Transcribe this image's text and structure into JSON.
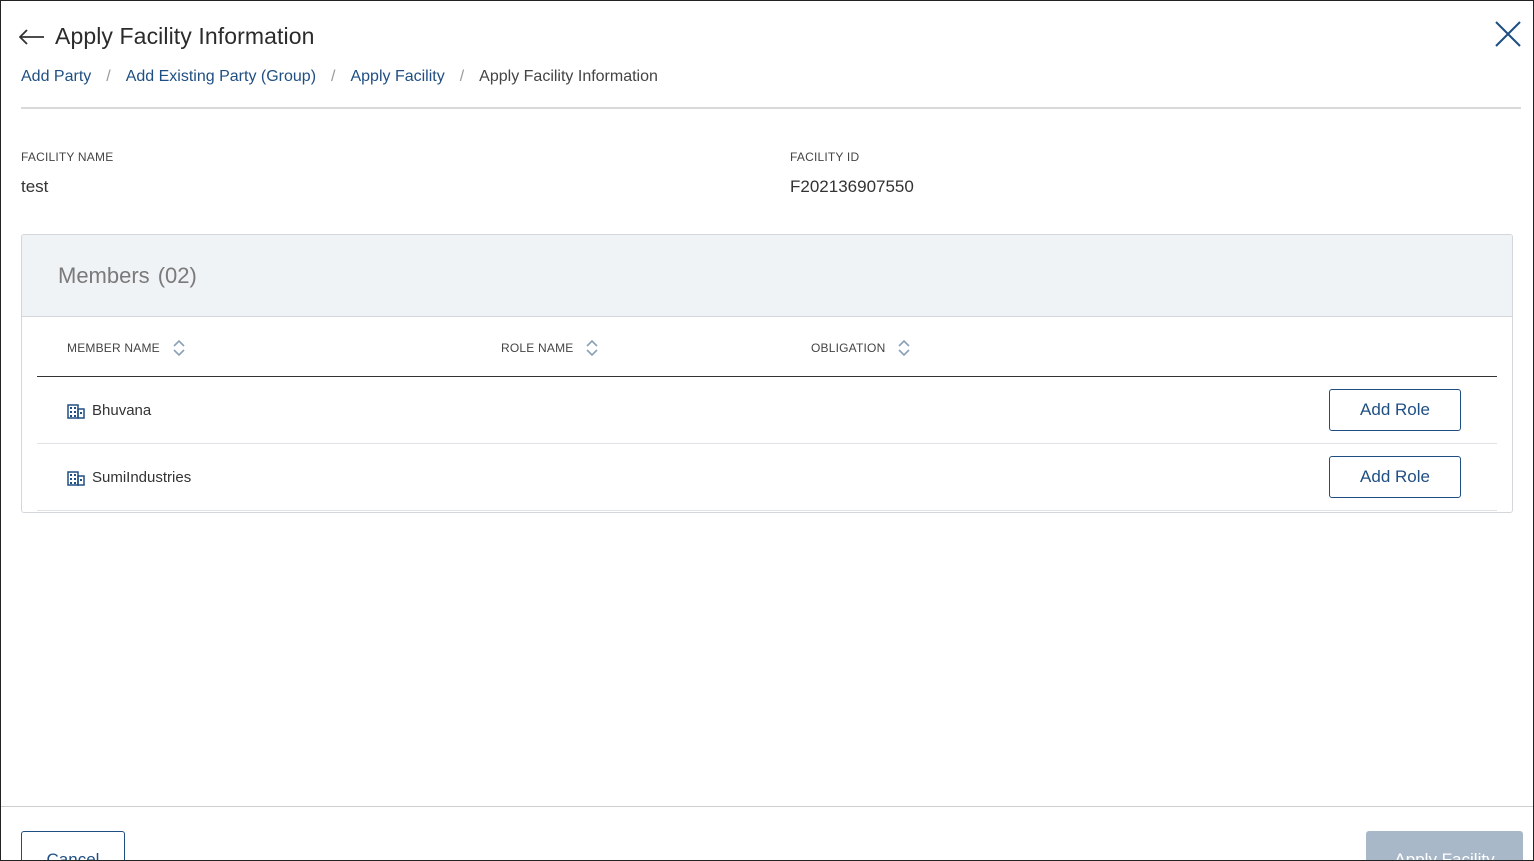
{
  "header": {
    "title": "Apply Facility Information",
    "back_icon": "arrow-left-icon",
    "close_icon": "close-icon"
  },
  "breadcrumb": {
    "items": [
      {
        "label": "Add Party"
      },
      {
        "label": "Add Existing Party (Group)"
      },
      {
        "label": "Apply Facility"
      }
    ],
    "current": "Apply Facility Information",
    "separator": "/"
  },
  "facility": {
    "name_label": "FACILITY NAME",
    "name_value": "test",
    "id_label": "FACILITY ID",
    "id_value": "F202136907550"
  },
  "members": {
    "title": "Members",
    "count": "(02)",
    "columns": [
      {
        "label": "MEMBER NAME"
      },
      {
        "label": "ROLE NAME"
      },
      {
        "label": "OBLIGATION"
      }
    ],
    "rows": [
      {
        "member_name": "Bhuvana",
        "role_name": "",
        "obligation": "",
        "action": "Add Role"
      },
      {
        "member_name": "SumiIndustries",
        "role_name": "",
        "obligation": "",
        "action": "Add Role"
      }
    ]
  },
  "footer": {
    "cancel_label": "Cancel",
    "apply_label": "Apply Facility"
  },
  "colors": {
    "link": "#1f4f82",
    "panel_header_bg": "#f0f3f6",
    "disabled_button": "#a9b8c8"
  }
}
